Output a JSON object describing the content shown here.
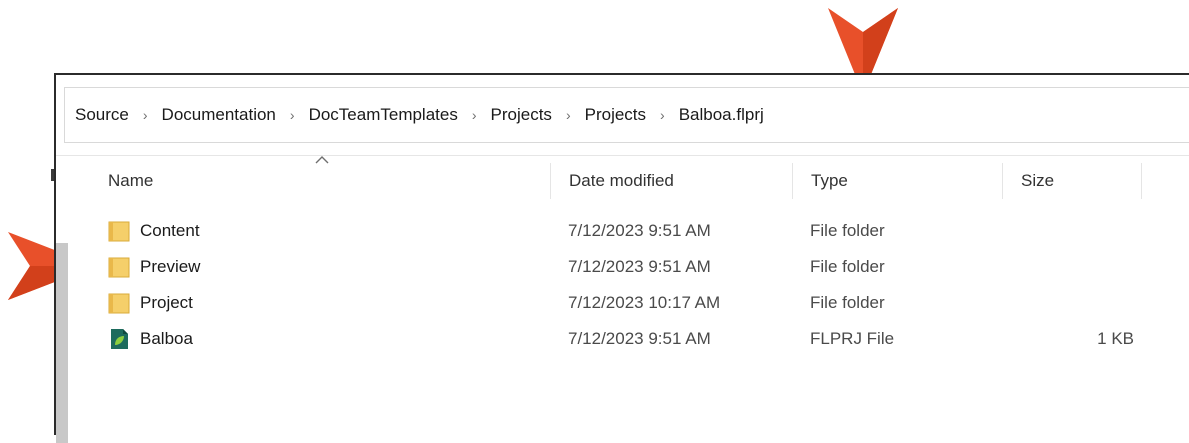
{
  "address_bar": {
    "crumbs": [
      "Source",
      "Documentation",
      "DocTeamTemplates",
      "Projects",
      "Projects",
      "Balboa.flprj"
    ],
    "separator": "›"
  },
  "columns": {
    "name": "Name",
    "date": "Date modified",
    "type": "Type",
    "size": "Size"
  },
  "sort_indicator": "^",
  "rows": [
    {
      "name": "Content",
      "date": "7/12/2023 9:51 AM",
      "type": "File folder",
      "size": "",
      "icon": "folder-icon"
    },
    {
      "name": "Preview",
      "date": "7/12/2023 9:51 AM",
      "type": "File folder",
      "size": "",
      "icon": "folder-icon"
    },
    {
      "name": "Project",
      "date": "7/12/2023 10:17 AM",
      "type": "File folder",
      "size": "",
      "icon": "folder-icon"
    },
    {
      "name": "Balboa",
      "date": "7/12/2023 9:51 AM",
      "type": "FLPRJ File",
      "size": "1 KB",
      "icon": "flprj-file-icon"
    }
  ],
  "colors": {
    "annotation_arrow": "#e8502a",
    "folder": "#f5cf6a",
    "flprj_icon": "#1d6b5d"
  }
}
